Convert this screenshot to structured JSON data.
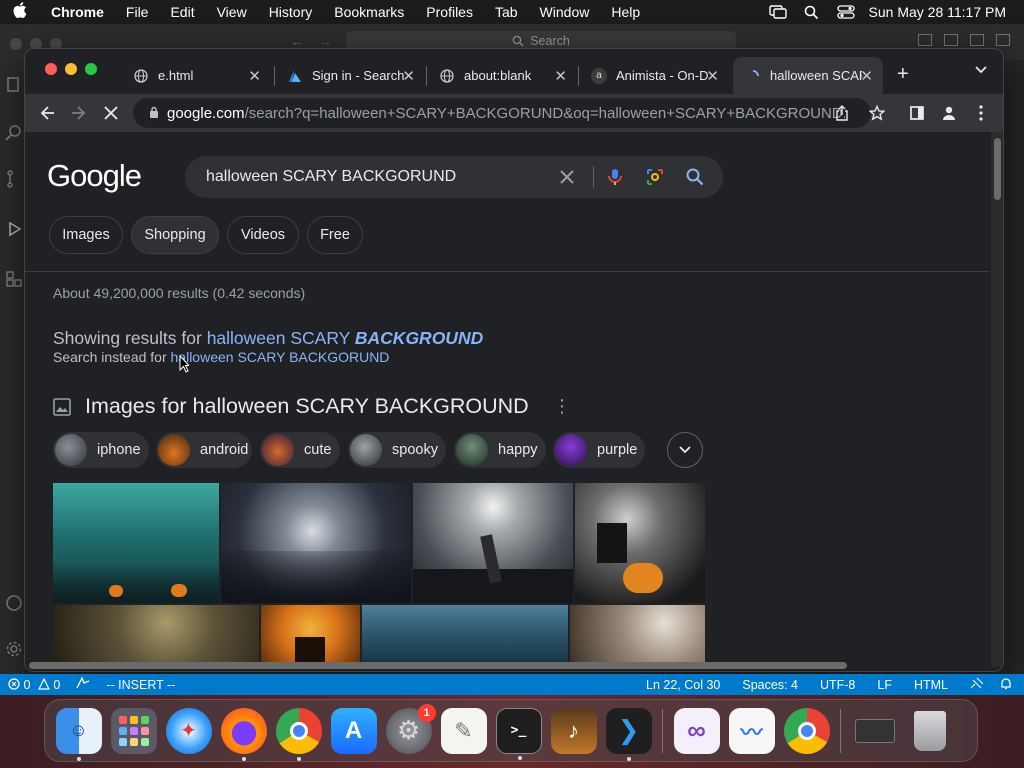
{
  "menubar": {
    "apple_icon": "apple-icon",
    "app_name": "Chrome",
    "items": [
      "File",
      "Edit",
      "View",
      "History",
      "Bookmarks",
      "Profiles",
      "Tab",
      "Window",
      "Help"
    ],
    "clock": "Sun May 28  11:17 PM"
  },
  "editor": {
    "search_placeholder": "Search",
    "status": {
      "errors": "0",
      "warnings": "0",
      "mode": "-- INSERT --",
      "position": "Ln 22, Col 30",
      "spaces": "Spaces: 4",
      "encoding": "UTF-8",
      "eol": "LF",
      "language": "HTML"
    }
  },
  "browser": {
    "tabs": [
      {
        "title": "e.html",
        "favicon": "globe-icon"
      },
      {
        "title": "Sign in - Search",
        "favicon": "azure-icon"
      },
      {
        "title": "about:blank",
        "favicon": "globe-icon"
      },
      {
        "title": "Animista - On-D",
        "favicon": "animista-icon"
      },
      {
        "title": "halloween SCARY",
        "favicon": "loading-icon",
        "active": true
      }
    ],
    "url_host": "google.com",
    "url_path": "/search?q=halloween+SCARY+BACKGORUND&oq=halloween+SCARY+BACKGROUND..."
  },
  "google": {
    "logo": "Google",
    "query": "halloween SCARY BACKGORUND",
    "filter_chips": [
      "Images",
      "Shopping",
      "Videos",
      "Free"
    ],
    "result_stats": "About 49,200,000 results (0.42 seconds)",
    "showing_prefix": "Showing results for ",
    "showing_plain": "halloween SCARY ",
    "showing_corrected": "BACKGROUND",
    "instead_prefix": "Search instead for ",
    "instead_link": "halloween SCARY BACKGORUND",
    "images_heading": "Images for halloween SCARY BACKGROUND",
    "image_chips": [
      "iphone",
      "android",
      "cute",
      "spooky",
      "happy",
      "purple"
    ]
  },
  "colors": {
    "accent_blue": "#8ab4f8",
    "statusbar": "#007acc",
    "page_bg": "#202124"
  },
  "dock": {
    "apps": [
      "Finder",
      "Launchpad",
      "Safari",
      "Firefox",
      "Chrome",
      "App Store",
      "System Settings",
      "TextEdit",
      "Terminal",
      "GarageBand",
      "Visual Studio Code",
      "Visual Studio",
      "Freeform",
      "Chrome",
      "Downloads",
      "Trash"
    ],
    "settings_badge": "1"
  }
}
